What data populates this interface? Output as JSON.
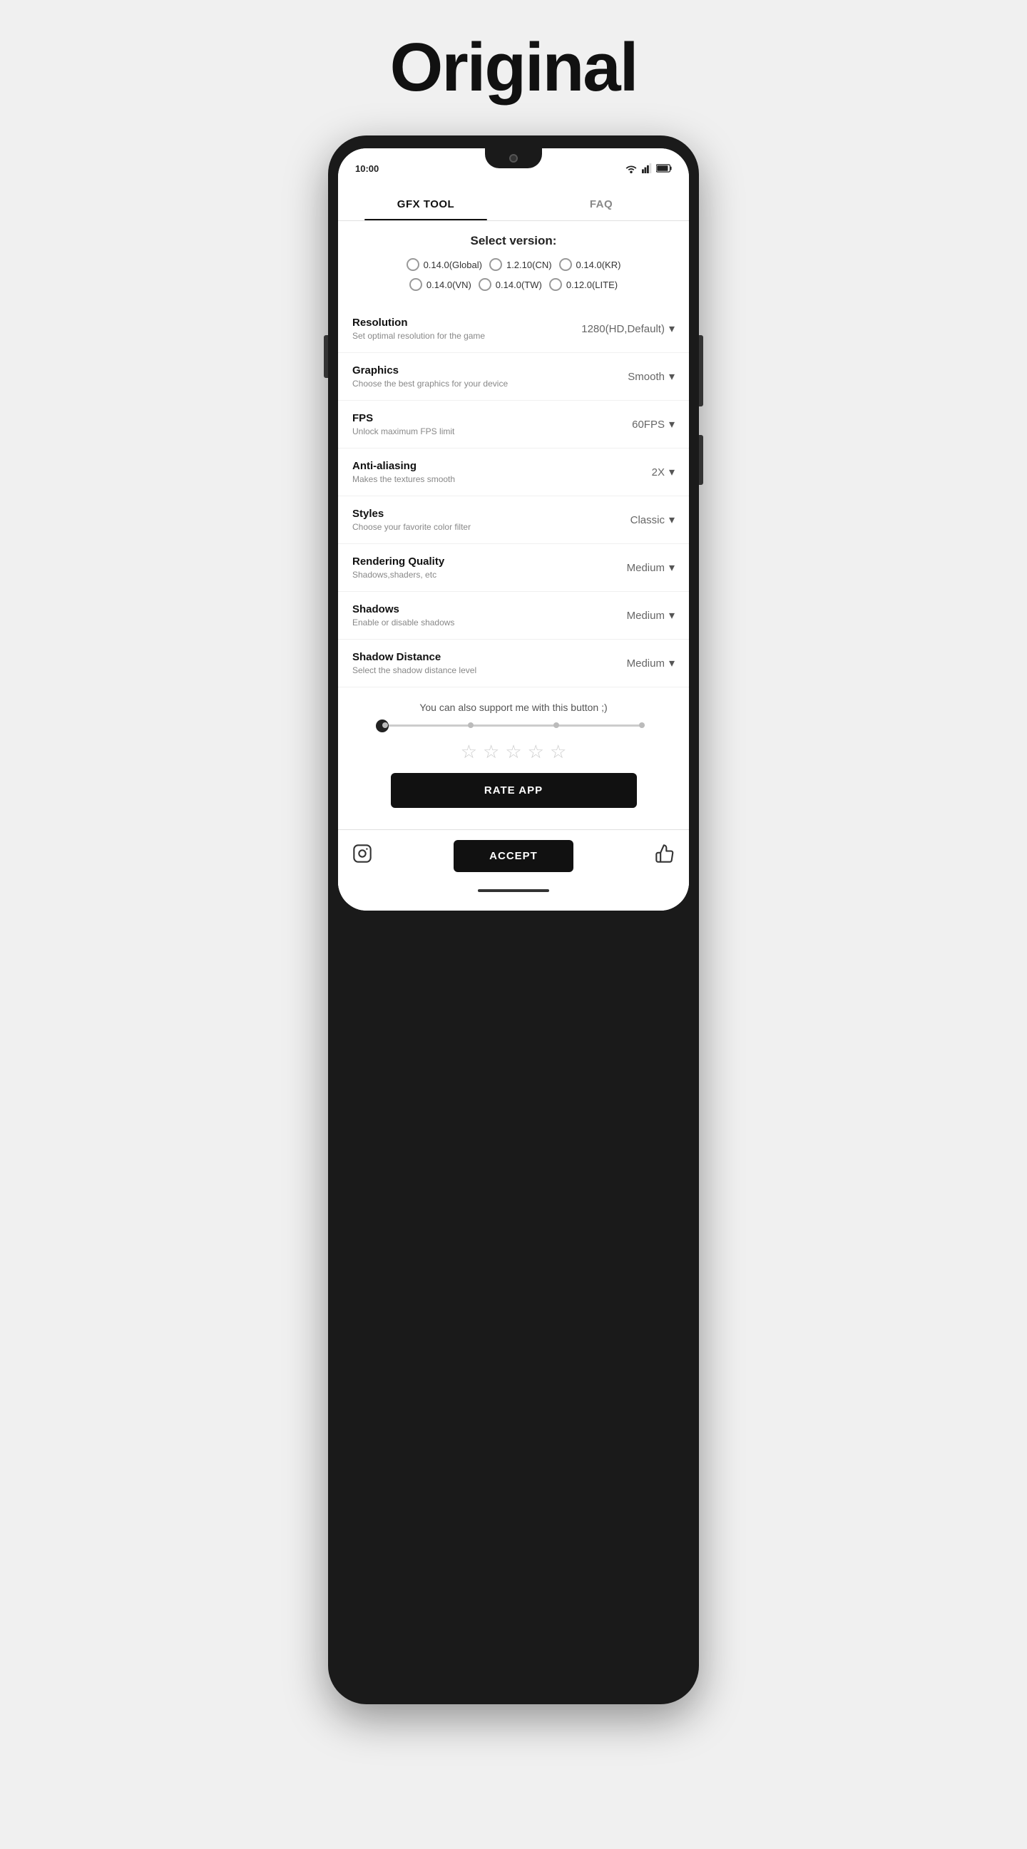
{
  "header": {
    "title": "Original"
  },
  "status_bar": {
    "time": "10:00"
  },
  "tabs": [
    {
      "id": "gfx-tool",
      "label": "GFX TOOL",
      "active": true
    },
    {
      "id": "faq",
      "label": "FAQ",
      "active": false
    }
  ],
  "version_section": {
    "title": "Select version:",
    "options": [
      "0.14.0(Global)",
      "1.2.10(CN)",
      "0.14.0(KR)",
      "0.14.0(VN)",
      "0.14.0(TW)",
      "0.12.0(LITE)"
    ]
  },
  "settings": [
    {
      "id": "resolution",
      "label": "Resolution",
      "desc": "Set optimal resolution for the game",
      "value": "1280(HD,Default)"
    },
    {
      "id": "graphics",
      "label": "Graphics",
      "desc": "Choose the best graphics for your device",
      "value": "Smooth"
    },
    {
      "id": "fps",
      "label": "FPS",
      "desc": "Unlock maximum FPS limit",
      "value": "60FPS"
    },
    {
      "id": "anti-aliasing",
      "label": "Anti-aliasing",
      "desc": "Makes the textures smooth",
      "value": "2X"
    },
    {
      "id": "styles",
      "label": "Styles",
      "desc": "Choose your favorite color filter",
      "value": "Classic"
    },
    {
      "id": "rendering-quality",
      "label": "Rendering Quality",
      "desc": "Shadows,shaders, etc",
      "value": "Medium"
    },
    {
      "id": "shadows",
      "label": "Shadows",
      "desc": "Enable or disable shadows",
      "value": "Medium"
    },
    {
      "id": "shadow-distance",
      "label": "Shadow Distance",
      "desc": "Select the shadow distance level",
      "value": "Medium"
    }
  ],
  "support": {
    "text": "You can also support me with this button ;)"
  },
  "stars": {
    "count": 5,
    "filled": 0
  },
  "buttons": {
    "rate_app": "RATE APP",
    "accept": "ACCEPT"
  }
}
